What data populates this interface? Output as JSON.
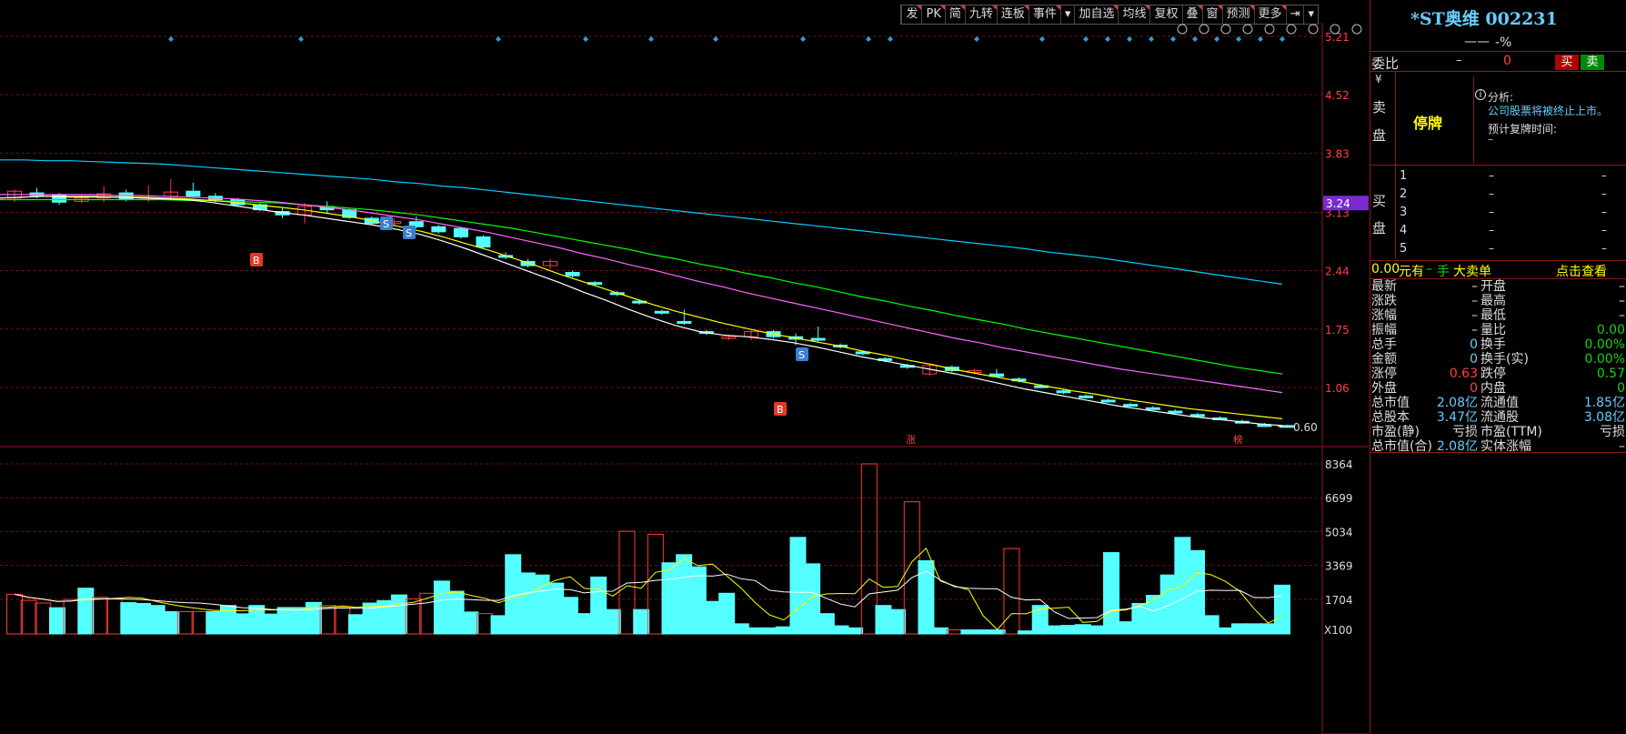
{
  "toolbar": {
    "items": [
      "发",
      "PK",
      "简",
      "九转",
      "连板",
      "事件",
      "▾",
      "加自选",
      "均线",
      "复权",
      "叠",
      "窗",
      "预测",
      "更多",
      "⇥",
      "▾"
    ]
  },
  "stock": {
    "title": "*ST奥维 002231",
    "price": "——",
    "change": "-%"
  },
  "weibi": {
    "label": "委比",
    "value1": "–",
    "value2": "0",
    "buy": "买",
    "sell": "卖"
  },
  "sell_side": {
    "label_yen": "¥",
    "label1": "卖",
    "label2": "盘",
    "status": "停牌",
    "analysis_label": "分析:",
    "analysis_text": "公司股票将被终止上市。",
    "resume_label": "预计复牌时间:",
    "resume_value": "–"
  },
  "buy_side": {
    "label1": "买",
    "label2": "盘",
    "levels": [
      "1",
      "2",
      "3",
      "4",
      "5"
    ],
    "dash": "–"
  },
  "big_order": {
    "amount": "0.00",
    "unit_yuan": "元有",
    "dash": "–",
    "hand": "手",
    "text": "大卖单",
    "link": "点击查看"
  },
  "stats": [
    {
      "l": "最新",
      "lv": "–",
      "r": "开盘",
      "rv": "–"
    },
    {
      "l": "涨跌",
      "lv": "–",
      "r": "最高",
      "rv": "–"
    },
    {
      "l": "涨幅",
      "lv": "–",
      "r": "最低",
      "rv": "–"
    },
    {
      "l": "振幅",
      "lv": "–",
      "r": "量比",
      "rv": "0.00"
    },
    {
      "l": "总手",
      "lv": "0",
      "r": "换手",
      "rv": "0.00%"
    },
    {
      "l": "金额",
      "lv": "0",
      "r": "换手(实)",
      "rv": "0.00%"
    },
    {
      "l": "涨停",
      "lv": "0.63",
      "r": "跌停",
      "rv": "0.57"
    },
    {
      "l": "外盘",
      "lv": "0",
      "r": "内盘",
      "rv": "0"
    },
    {
      "l": "总市值",
      "lv": "2.08亿",
      "r": "流通值",
      "rv": "1.85亿"
    },
    {
      "l": "总股本",
      "lv": "3.47亿",
      "r": "流通股",
      "rv": "3.08亿"
    },
    {
      "l": "市盈(静)",
      "lv": "亏损",
      "r": "市盈(TTM)",
      "rv": "亏损"
    },
    {
      "l": "总市值(合)",
      "lv": "2.08亿",
      "r": "实体涨幅",
      "rv": "–"
    }
  ],
  "colors": {
    "up": "#ff3b3b",
    "down": "#54ffff",
    "ma5": "#ffffff",
    "ma10": "#ffff00",
    "ma20": "#ff66ff",
    "ma30": "#00ff00",
    "ma60": "#00d0ff",
    "accent_red": "#8b1a1a"
  },
  "chart_data": {
    "type": "candlestick",
    "price_axis": {
      "ticks": [
        "5.21",
        "4.52",
        "3.83",
        "3.13",
        "2.44",
        "1.75",
        "1.06"
      ],
      "current": "3.24",
      "last_label": "0.60"
    },
    "volume_axis": {
      "ticks": [
        "8364",
        "6699",
        "5034",
        "3369",
        "1704"
      ],
      "unit": "X100"
    },
    "markers": {
      "zhang": "涨",
      "bang": "榜",
      "buy": "B",
      "sell": "S"
    },
    "candles": [
      [
        3.3,
        3.4,
        3.25,
        3.38
      ],
      [
        3.36,
        3.42,
        3.3,
        3.33
      ],
      [
        3.33,
        3.36,
        3.22,
        3.25
      ],
      [
        3.26,
        3.34,
        3.24,
        3.3
      ],
      [
        3.3,
        3.44,
        3.25,
        3.35
      ],
      [
        3.36,
        3.4,
        3.26,
        3.28
      ],
      [
        3.28,
        3.45,
        3.25,
        3.3
      ],
      [
        3.32,
        3.52,
        3.28,
        3.37
      ],
      [
        3.38,
        3.48,
        3.3,
        3.32
      ],
      [
        3.32,
        3.36,
        3.25,
        3.28
      ],
      [
        3.28,
        3.3,
        3.2,
        3.22
      ],
      [
        3.22,
        3.24,
        3.14,
        3.16
      ],
      [
        3.14,
        3.18,
        3.06,
        3.1
      ],
      [
        3.1,
        3.24,
        3.0,
        3.2
      ],
      [
        3.2,
        3.26,
        3.12,
        3.16
      ],
      [
        3.16,
        3.18,
        3.05,
        3.07
      ],
      [
        3.06,
        3.08,
        2.98,
        3.0
      ],
      [
        3.0,
        3.06,
        2.96,
        3.02
      ],
      [
        3.02,
        3.08,
        2.94,
        2.96
      ],
      [
        2.96,
        2.98,
        2.88,
        2.9
      ],
      [
        2.94,
        2.96,
        2.82,
        2.84
      ],
      [
        2.84,
        2.86,
        2.7,
        2.72
      ],
      [
        2.62,
        2.66,
        2.58,
        2.6
      ],
      [
        2.55,
        2.58,
        2.48,
        2.5
      ],
      [
        2.5,
        2.58,
        2.46,
        2.55
      ],
      [
        2.42,
        2.44,
        2.36,
        2.38
      ],
      [
        2.3,
        2.32,
        2.26,
        2.28
      ],
      [
        2.18,
        2.2,
        2.14,
        2.16
      ],
      [
        2.08,
        2.1,
        2.04,
        2.06
      ],
      [
        1.96,
        1.98,
        1.92,
        1.94
      ],
      [
        1.84,
        1.98,
        1.8,
        1.82
      ],
      [
        1.72,
        1.74,
        1.68,
        1.7
      ],
      [
        1.64,
        1.68,
        1.62,
        1.66
      ],
      [
        1.66,
        1.74,
        1.62,
        1.72
      ],
      [
        1.72,
        1.74,
        1.64,
        1.66
      ],
      [
        1.66,
        1.7,
        1.56,
        1.63
      ],
      [
        1.64,
        1.78,
        1.6,
        1.62
      ],
      [
        1.56,
        1.58,
        1.52,
        1.54
      ],
      [
        1.48,
        1.5,
        1.44,
        1.46
      ],
      [
        1.4,
        1.42,
        1.36,
        1.38
      ],
      [
        1.32,
        1.34,
        1.28,
        1.3
      ],
      [
        1.22,
        1.34,
        1.2,
        1.32
      ],
      [
        1.3,
        1.32,
        1.24,
        1.26
      ],
      [
        1.24,
        1.28,
        1.22,
        1.26
      ],
      [
        1.22,
        1.28,
        1.18,
        1.19
      ],
      [
        1.16,
        1.18,
        1.12,
        1.14
      ],
      [
        1.08,
        1.1,
        1.05,
        1.07
      ],
      [
        1.02,
        1.04,
        0.98,
        1.0
      ],
      [
        0.96,
        0.98,
        0.93,
        0.95
      ],
      [
        0.91,
        0.93,
        0.88,
        0.9
      ],
      [
        0.86,
        0.88,
        0.84,
        0.85
      ],
      [
        0.82,
        0.84,
        0.8,
        0.81
      ],
      [
        0.78,
        0.8,
        0.76,
        0.77
      ],
      [
        0.74,
        0.76,
        0.72,
        0.73
      ],
      [
        0.7,
        0.72,
        0.68,
        0.69
      ],
      [
        0.66,
        0.68,
        0.64,
        0.65
      ],
      [
        0.62,
        0.64,
        0.6,
        0.61
      ],
      [
        0.61,
        0.62,
        0.6,
        0.6
      ]
    ],
    "volumes": [
      1950,
      1650,
      1520,
      1290,
      1700,
      2250,
      1800,
      1710,
      1540,
      1500,
      1400,
      1100,
      1100,
      1100,
      1100,
      1400,
      990,
      1400,
      980,
      1300,
      1300,
      1550,
      1400,
      1330,
      950,
      1520,
      1640,
      1920,
      1730,
      2000,
      2600,
      2100,
      1080,
      1000,
      900,
      3900,
      3000,
      2900,
      2500,
      1800,
      1000,
      2800,
      1200,
      5050,
      1200,
      4900,
      3500,
      3900,
      3300,
      1600,
      2000,
      500,
      300,
      300,
      350,
      4750,
      3450,
      1000,
      400,
      300,
      8364,
      1400,
      1200,
      6500,
      3600,
      300,
      200,
      200,
      200,
      200,
      4200,
      150,
      1400,
      400,
      420,
      460,
      400,
      4000,
      600,
      1500,
      1900,
      2900,
      4750,
      4100,
      900,
      300,
      500,
      500,
      500,
      2400
    ],
    "ma5": [
      3.3,
      3.31,
      3.32,
      3.31,
      3.31,
      3.31,
      3.3,
      3.29,
      3.28,
      3.25,
      3.21,
      3.17,
      3.13,
      3.1,
      3.06,
      3.02,
      2.98,
      2.93,
      2.87,
      2.79,
      2.7,
      2.6,
      2.5,
      2.4,
      2.3,
      2.19,
      2.09,
      1.98,
      1.88,
      1.79,
      1.72,
      1.68,
      1.66,
      1.63,
      1.59,
      1.54,
      1.48,
      1.42,
      1.37,
      1.32,
      1.27,
      1.22,
      1.16,
      1.1,
      1.04,
      0.99,
      0.94,
      0.89,
      0.84,
      0.8,
      0.76,
      0.72,
      0.69,
      0.66,
      0.63,
      0.61
    ],
    "ma10": [
      3.3,
      3.31,
      3.32,
      3.32,
      3.32,
      3.31,
      3.31,
      3.3,
      3.29,
      3.27,
      3.25,
      3.22,
      3.19,
      3.16,
      3.12,
      3.08,
      3.03,
      2.97,
      2.91,
      2.84,
      2.76,
      2.68,
      2.59,
      2.5,
      2.4,
      2.31,
      2.22,
      2.13,
      2.04,
      1.96,
      1.89,
      1.82,
      1.76,
      1.7,
      1.65,
      1.6,
      1.55,
      1.49,
      1.44,
      1.38,
      1.33,
      1.27,
      1.22,
      1.17,
      1.12,
      1.07,
      1.02,
      0.98,
      0.93,
      0.89,
      0.85,
      0.81,
      0.78,
      0.75,
      0.72,
      0.69
    ],
    "ma20": [
      3.34,
      3.34,
      3.34,
      3.34,
      3.34,
      3.33,
      3.33,
      3.32,
      3.31,
      3.3,
      3.29,
      3.27,
      3.25,
      3.22,
      3.19,
      3.16,
      3.12,
      3.08,
      3.04,
      2.99,
      2.94,
      2.89,
      2.83,
      2.77,
      2.71,
      2.64,
      2.58,
      2.51,
      2.45,
      2.38,
      2.31,
      2.25,
      2.18,
      2.12,
      2.06,
      2.0,
      1.94,
      1.88,
      1.82,
      1.76,
      1.7,
      1.64,
      1.59,
      1.53,
      1.48,
      1.43,
      1.38,
      1.33,
      1.28,
      1.24,
      1.2,
      1.16,
      1.12,
      1.08,
      1.04,
      1.0
    ],
    "ma30": [
      3.28,
      3.28,
      3.28,
      3.28,
      3.28,
      3.28,
      3.28,
      3.28,
      3.27,
      3.27,
      3.26,
      3.25,
      3.24,
      3.22,
      3.2,
      3.18,
      3.16,
      3.13,
      3.1,
      3.06,
      3.02,
      2.98,
      2.94,
      2.89,
      2.84,
      2.79,
      2.74,
      2.69,
      2.63,
      2.58,
      2.52,
      2.47,
      2.41,
      2.36,
      2.3,
      2.25,
      2.19,
      2.13,
      2.08,
      2.02,
      1.97,
      1.91,
      1.86,
      1.81,
      1.75,
      1.7,
      1.65,
      1.6,
      1.55,
      1.5,
      1.45,
      1.4,
      1.35,
      1.3,
      1.26,
      1.22
    ],
    "ma60": [
      3.75,
      3.75,
      3.74,
      3.74,
      3.73,
      3.72,
      3.71,
      3.7,
      3.68,
      3.66,
      3.64,
      3.62,
      3.6,
      3.58,
      3.56,
      3.54,
      3.52,
      3.49,
      3.47,
      3.44,
      3.42,
      3.39,
      3.36,
      3.33,
      3.3,
      3.27,
      3.24,
      3.21,
      3.18,
      3.15,
      3.12,
      3.09,
      3.06,
      3.03,
      3.0,
      2.97,
      2.94,
      2.91,
      2.88,
      2.85,
      2.82,
      2.79,
      2.76,
      2.73,
      2.7,
      2.66,
      2.63,
      2.6,
      2.56,
      2.52,
      2.48,
      2.44,
      2.4,
      2.36,
      2.32,
      2.28
    ]
  }
}
